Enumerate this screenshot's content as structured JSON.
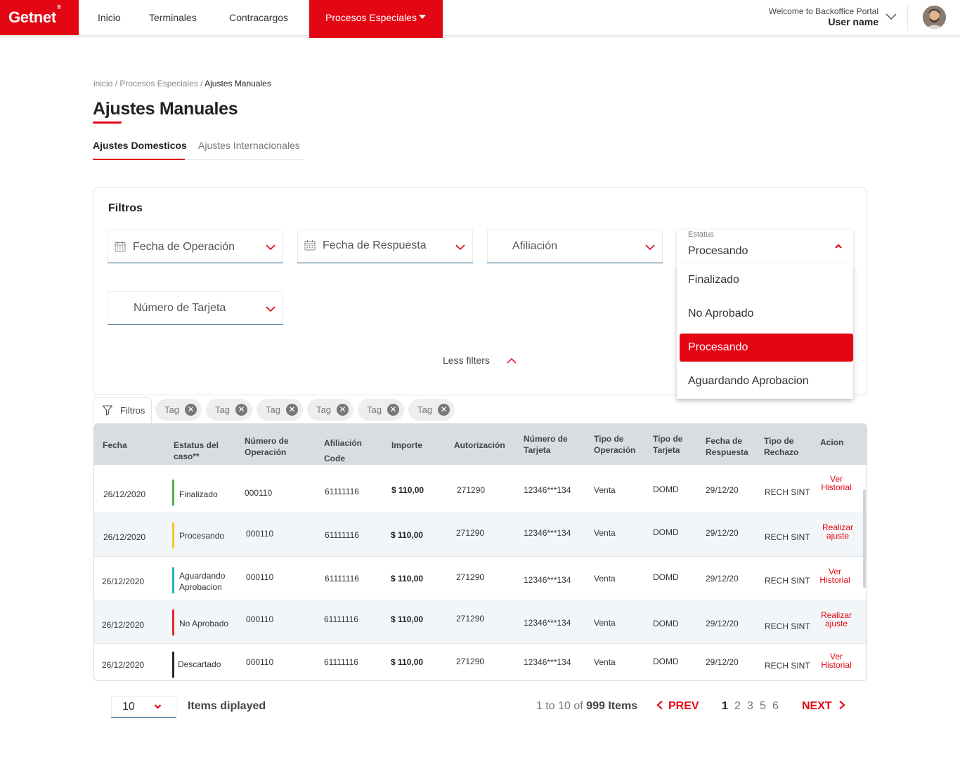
{
  "nav": {
    "brand": "Getnet",
    "items": [
      "Inicio",
      "Terminales",
      "Contracargos",
      "Procesos Especiales"
    ],
    "welcome": "Welcome to Backoffice Portal",
    "user_name": "User name"
  },
  "breadcrumb": {
    "home": "inicio",
    "sep1": " / ",
    "section": "Procesos Especiales",
    "sep2": " / ",
    "current": "Ajustes Manuales"
  },
  "page_title": "Ajustes Manuales",
  "tabs": [
    "Ajustes Domesticos",
    "Ajustes Internacionales"
  ],
  "filters": {
    "title": "Filtros",
    "fecha_operacion": "Fecha de Operación",
    "fecha_respuesta": "Fecha de Respuesta",
    "afiliacion": "Afiliación",
    "numero_tarjeta": "Número de Tarjeta",
    "estatus_label": "Estatus",
    "estatus_value": "Procesando",
    "estatus_options": [
      "Finalizado",
      "No Aprobado",
      "Procesando",
      "Aguardando Aprobacion"
    ],
    "less_filters": "Less filters"
  },
  "chips": {
    "filter_label": "Filtros",
    "tags": [
      "Tag",
      "Tag",
      "Tag",
      "Tag",
      "Tag",
      "Tag"
    ]
  },
  "table": {
    "headers": [
      [
        "Fecha"
      ],
      [
        "Estatus del",
        "caso**"
      ],
      [
        "Número de",
        "Operación"
      ],
      [
        "Afiliación",
        "Code"
      ],
      [
        "Importe"
      ],
      [
        "Autorización"
      ],
      [
        "Número de",
        "Tarjeta"
      ],
      [
        "Tipo de",
        "Operación"
      ],
      [
        "Tipo de",
        "Tarjeta"
      ],
      [
        "Fecha de",
        "Respuesta"
      ],
      [
        "Tipo de",
        "Rechazo"
      ],
      [
        "Acion"
      ]
    ],
    "rows": [
      {
        "fecha": "26/12/2020",
        "estatus": [
          "Finalizado"
        ],
        "status_color": "#4cb050",
        "operacion": "000110",
        "afiliacion": "61111116",
        "importe": "$ 110,00",
        "autorizacion": "271290",
        "tarjeta": "12346***134",
        "tipo_operacion": "Venta",
        "tipo_tarjeta": "DOMD",
        "fecha_respuesta": "29/12/20",
        "rechazo": "RECH SINT",
        "accion": [
          "Ver",
          "Historial"
        ]
      },
      {
        "fecha": "26/12/2020",
        "estatus": [
          "Procesando"
        ],
        "status_color": "#f7c325",
        "operacion": "000110",
        "afiliacion": "61111116",
        "importe": "$ 110,00",
        "autorizacion": "271290",
        "tarjeta": "12346***134",
        "tipo_operacion": "Venta",
        "tipo_tarjeta": "DOMD",
        "fecha_respuesta": "29/12/20",
        "rechazo": "RECH SINT",
        "accion": [
          "Realizar",
          "ajuste"
        ]
      },
      {
        "fecha": "26/12/2020",
        "estatus": [
          "Aguardando",
          "Aprobacion"
        ],
        "status_color": "#1fb3b8",
        "operacion": "000110",
        "afiliacion": "61111116",
        "importe": "$ 110,00",
        "autorizacion": "271290",
        "tarjeta": "12346***134",
        "tipo_operacion": "Venta",
        "tipo_tarjeta": "DOMD",
        "fecha_respuesta": "29/12/20",
        "rechazo": "RECH SINT",
        "accion": [
          "Ver",
          "Historial"
        ]
      },
      {
        "fecha": "26/12/2020",
        "estatus": [
          "No Aprobado"
        ],
        "status_color": "#e3262e",
        "operacion": "000110",
        "afiliacion": "61111116",
        "importe": "$ 110,00",
        "autorizacion": "271290",
        "tarjeta": "12346***134",
        "tipo_operacion": "Venta",
        "tipo_tarjeta": "DOMD",
        "fecha_respuesta": "29/12/20",
        "rechazo": "RECH SINT",
        "accion": [
          "Realizar",
          "ajuste"
        ]
      },
      {
        "fecha": "26/12/2020",
        "estatus": [
          "Descartado"
        ],
        "status_color": "#1f2733",
        "operacion": "000110",
        "afiliacion": "61111116",
        "importe": "$ 110,00",
        "autorizacion": "271290",
        "tarjeta": "12346***134",
        "tipo_operacion": "Venta",
        "tipo_tarjeta": "DOMD",
        "fecha_respuesta": "29/12/20",
        "rechazo": "RECH SINT",
        "accion": [
          "Ver",
          "Historial"
        ]
      }
    ]
  },
  "pagination": {
    "per_page": "10",
    "items_label": "Items diplayed",
    "range_prefix": "1 to 10 of ",
    "range_total": "999 Items",
    "prev": "PREV",
    "next": "NEXT",
    "pages": [
      "1",
      "2",
      "3",
      "5",
      "6"
    ],
    "current_page": "1"
  },
  "colors": {
    "brand_red": "#e30613",
    "input_underline": "#2e6f93",
    "header_gray": "#d8dde1"
  }
}
